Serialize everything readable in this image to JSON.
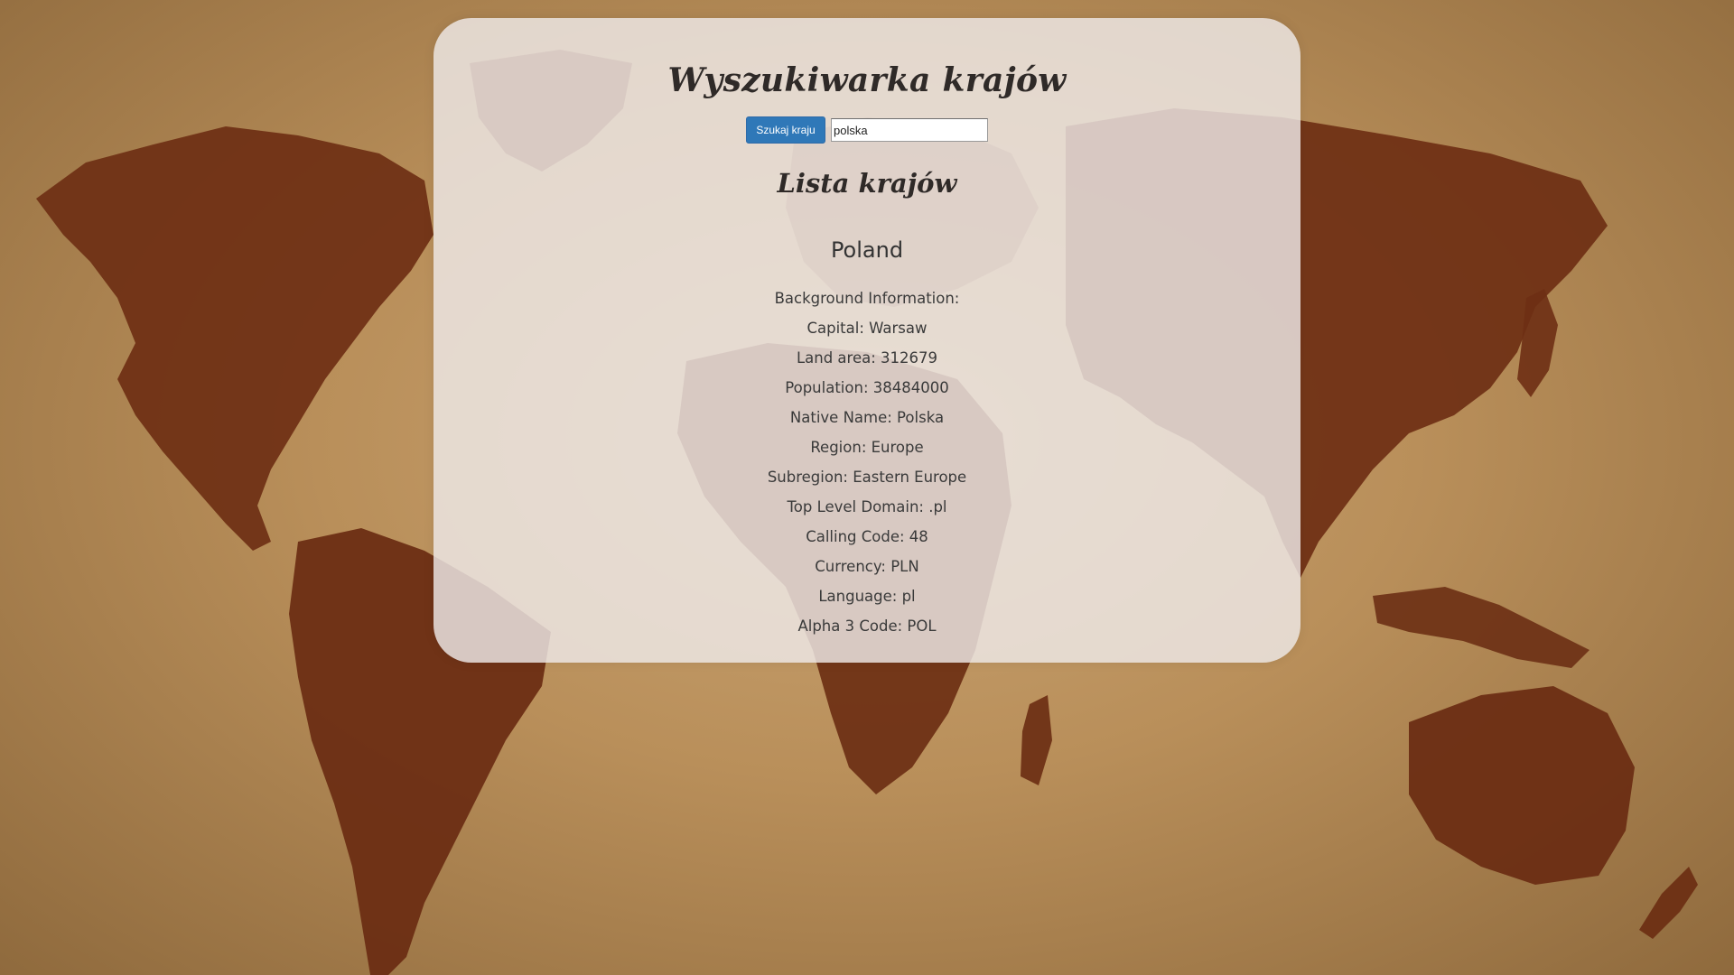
{
  "page": {
    "title": "Wyszukiwarka krajów"
  },
  "search": {
    "button_label": "Szukaj kraju",
    "input_value": "polska",
    "input_placeholder": ""
  },
  "list": {
    "title": "Lista krajów"
  },
  "country": {
    "name": "Poland",
    "details": [
      "Background Information:",
      "Capital: Warsaw",
      "Land area: 312679",
      "Population: 38484000",
      "Native Name: Polska",
      "Region: Europe",
      "Subregion: Eastern Europe",
      "Top Level Domain: .pl",
      "Calling Code: 48",
      "Currency: PLN",
      "Language: pl",
      "Alpha 3 Code: POL"
    ]
  },
  "colors": {
    "button": "#2f78b8",
    "panel": "#eee9e8",
    "map_land": "#6b2d12",
    "background": "#b98f5a"
  }
}
